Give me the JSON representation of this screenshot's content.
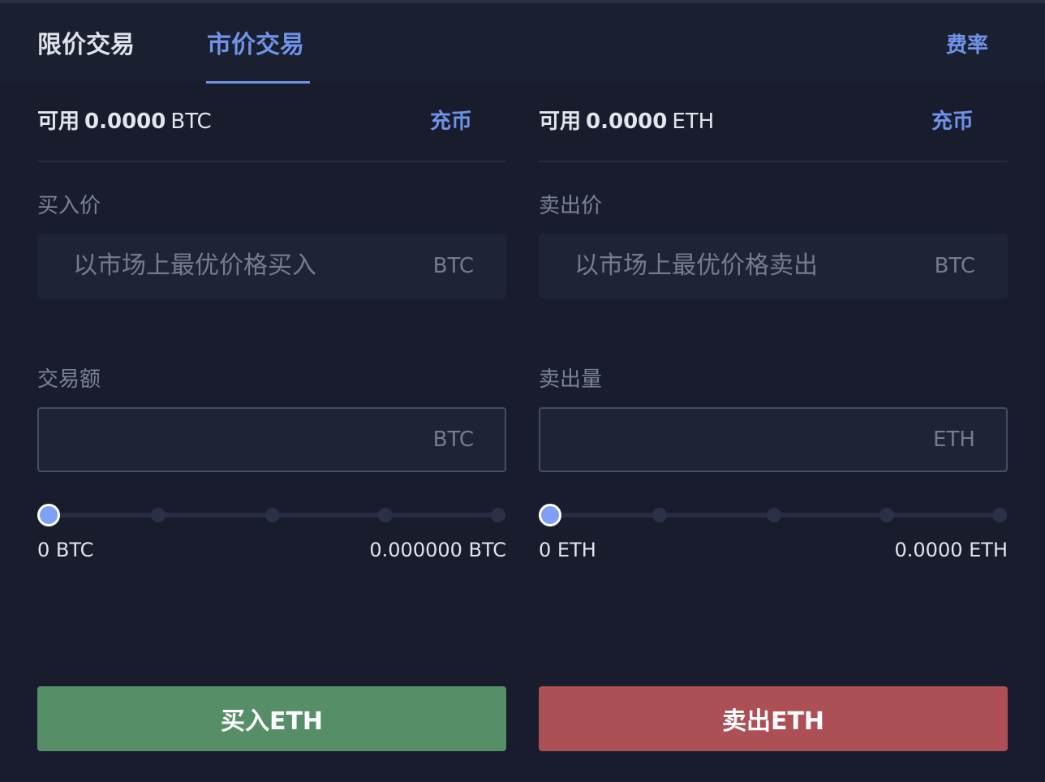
{
  "tabs": {
    "limit": "限价交易",
    "market": "市价交易",
    "fee": "费率"
  },
  "buy": {
    "available_label": "可用",
    "available_amount": "0.0000",
    "available_currency": "BTC",
    "deposit": "充币",
    "price_label": "买入价",
    "price_placeholder": "以市场上最优价格买入",
    "price_unit": "BTC",
    "amount_label": "交易额",
    "amount_value": "",
    "amount_unit": "BTC",
    "slider_value_percent": 0,
    "range_min": "0 BTC",
    "range_max": "0.000000 BTC",
    "button": "买入ETH",
    "button_color": "#568e67"
  },
  "sell": {
    "available_label": "可用",
    "available_amount": "0.0000",
    "available_currency": "ETH",
    "deposit": "充币",
    "price_label": "卖出价",
    "price_placeholder": "以市场上最优价格卖出",
    "price_unit": "BTC",
    "amount_label": "卖出量",
    "amount_value": "",
    "amount_unit": "ETH",
    "slider_value_percent": 0,
    "range_min": "0 ETH",
    "range_max": "0.0000 ETH",
    "button": "卖出ETH",
    "button_color": "#ac5055"
  },
  "colors": {
    "accent": "#6f93e9",
    "background": "#181c2c",
    "slider_handle": "#7ea0f5"
  }
}
